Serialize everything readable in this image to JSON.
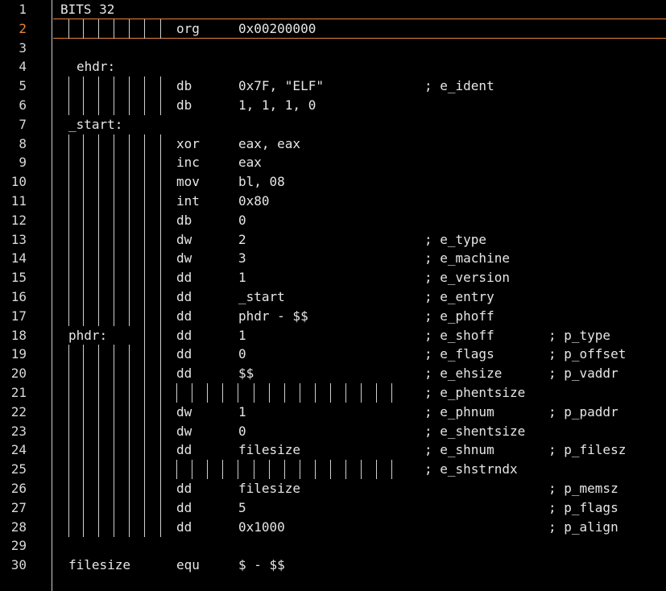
{
  "editor": {
    "active_line": 2,
    "colors": {
      "background": "#000000",
      "text": "#e6e6e6",
      "active_line_number": "#e8843a",
      "guides": "#cfcfcf"
    },
    "lines": [
      {
        "n": "1",
        "label": "BITS 32",
        "label_col": "bits",
        "guides": "none",
        "mnemonic": "",
        "operand": "",
        "comment1": "",
        "comment2": ""
      },
      {
        "n": "2",
        "label": "",
        "guides": "full",
        "mnemonic": "org",
        "operand": "0x00200000",
        "comment1": "",
        "comment2": ""
      },
      {
        "n": "3",
        "label": "",
        "guides": "none",
        "mnemonic": "",
        "operand": "",
        "comment1": "",
        "comment2": ""
      },
      {
        "n": "4",
        "label": "ehdr:",
        "label_col": "ehdr",
        "guides": "none",
        "mnemonic": "",
        "operand": "",
        "comment1": "",
        "comment2": ""
      },
      {
        "n": "5",
        "label": "",
        "guides": "full",
        "mnemonic": "db",
        "operand": "0x7F, \"ELF\"",
        "comment1": "; e_ident",
        "comment2": ""
      },
      {
        "n": "6",
        "label": "",
        "guides": "full",
        "mnemonic": "db",
        "operand": "1, 1, 1, 0",
        "comment1": "",
        "comment2": ""
      },
      {
        "n": "7",
        "label": "_start:",
        "label_col": "label",
        "guides": "none",
        "mnemonic": "",
        "operand": "",
        "comment1": "",
        "comment2": ""
      },
      {
        "n": "8",
        "label": "",
        "guides": "full",
        "mnemonic": "xor",
        "operand": "eax, eax",
        "comment1": "",
        "comment2": ""
      },
      {
        "n": "9",
        "label": "",
        "guides": "full",
        "mnemonic": "inc",
        "operand": "eax",
        "comment1": "",
        "comment2": ""
      },
      {
        "n": "10",
        "label": "",
        "guides": "full",
        "mnemonic": "mov",
        "operand": "bl, 08",
        "comment1": "",
        "comment2": ""
      },
      {
        "n": "11",
        "label": "",
        "guides": "full",
        "mnemonic": "int",
        "operand": "0x80",
        "comment1": "",
        "comment2": ""
      },
      {
        "n": "12",
        "label": "",
        "guides": "full",
        "mnemonic": "db",
        "operand": "0",
        "comment1": "",
        "comment2": ""
      },
      {
        "n": "13",
        "label": "",
        "guides": "full",
        "mnemonic": "dw",
        "operand": "2",
        "comment1": "; e_type",
        "comment2": ""
      },
      {
        "n": "14",
        "label": "",
        "guides": "full",
        "mnemonic": "dw",
        "operand": "3",
        "comment1": "; e_machine",
        "comment2": ""
      },
      {
        "n": "15",
        "label": "",
        "guides": "full",
        "mnemonic": "dd",
        "operand": "1",
        "comment1": "; e_version",
        "comment2": ""
      },
      {
        "n": "16",
        "label": "",
        "guides": "full",
        "mnemonic": "dd",
        "operand": "_start",
        "comment1": "; e_entry",
        "comment2": ""
      },
      {
        "n": "17",
        "label": "",
        "guides": "full",
        "mnemonic": "dd",
        "operand": "phdr - $$",
        "comment1": "; e_phoff",
        "comment2": ""
      },
      {
        "n": "18",
        "label": "phdr:",
        "label_col": "label",
        "guides": "tail",
        "mnemonic": "dd",
        "operand": "1",
        "comment1": "; e_shoff",
        "comment2": "; p_type"
      },
      {
        "n": "19",
        "label": "",
        "guides": "full",
        "mnemonic": "dd",
        "operand": "0",
        "comment1": "; e_flags",
        "comment2": "; p_offset"
      },
      {
        "n": "20",
        "label": "",
        "guides": "full",
        "mnemonic": "dd",
        "operand": "$$",
        "comment1": "; e_ehsize",
        "comment2": "; p_vaddr"
      },
      {
        "n": "21",
        "label": "",
        "guides": "extended",
        "mnemonic": "",
        "operand": "",
        "comment1": "; e_phentsize",
        "comment2": ""
      },
      {
        "n": "22",
        "label": "",
        "guides": "full",
        "mnemonic": "dw",
        "operand": "1",
        "comment1": "; e_phnum",
        "comment2": "; p_paddr"
      },
      {
        "n": "23",
        "label": "",
        "guides": "full",
        "mnemonic": "dw",
        "operand": "0",
        "comment1": "; e_shentsize",
        "comment2": ""
      },
      {
        "n": "24",
        "label": "",
        "guides": "full",
        "mnemonic": "dd",
        "operand": "filesize",
        "comment1": "; e_shnum",
        "comment2": "; p_filesz"
      },
      {
        "n": "25",
        "label": "",
        "guides": "extended",
        "mnemonic": "",
        "operand": "",
        "comment1": "; e_shstrndx",
        "comment2": ""
      },
      {
        "n": "26",
        "label": "",
        "guides": "full",
        "mnemonic": "dd",
        "operand": "filesize",
        "comment1": "",
        "comment2": "; p_memsz"
      },
      {
        "n": "27",
        "label": "",
        "guides": "full",
        "mnemonic": "dd",
        "operand": "5",
        "comment1": "",
        "comment2": "; p_flags"
      },
      {
        "n": "28",
        "label": "",
        "guides": "full",
        "mnemonic": "dd",
        "operand": "0x1000",
        "comment1": "",
        "comment2": "; p_align"
      },
      {
        "n": "29",
        "label": "",
        "guides": "none",
        "mnemonic": "",
        "operand": "",
        "comment1": "",
        "comment2": ""
      },
      {
        "n": "30",
        "label": "filesize",
        "label_col": "label",
        "guides": "none",
        "mnemonic": "equ",
        "operand": "$ - $$",
        "comment1": "",
        "comment2": ""
      }
    ]
  }
}
